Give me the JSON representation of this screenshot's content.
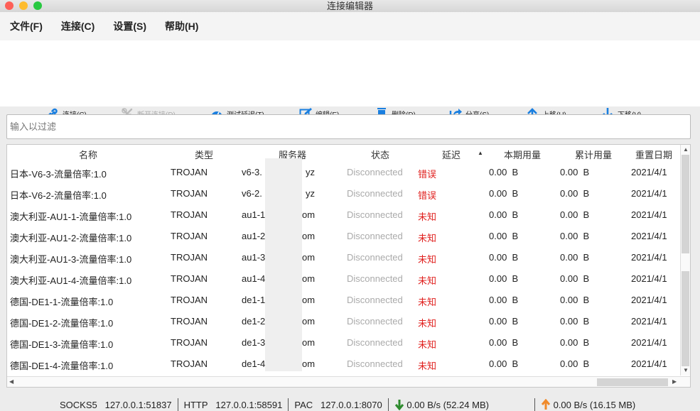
{
  "window": {
    "title": "连接编辑器"
  },
  "menu": [
    "文件(F)",
    "连接(C)",
    "设置(S)",
    "帮助(H)"
  ],
  "toolbar": [
    {
      "label": "连接(C)",
      "icon": "link-icon",
      "enabled": true
    },
    {
      "label": "断开连接(D)",
      "icon": "unlink-icon",
      "enabled": false
    },
    {
      "label": "测试延迟(T)",
      "icon": "speedometer-icon",
      "enabled": true
    },
    {
      "label": "编辑(E)",
      "icon": "edit-icon",
      "enabled": true
    },
    {
      "label": "删除(D)",
      "icon": "trash-icon",
      "enabled": true
    },
    {
      "label": "分享(S)",
      "icon": "share-icon",
      "enabled": true
    },
    {
      "label": "上移(U)",
      "icon": "arrow-up-icon",
      "enabled": true
    },
    {
      "label": "下移(V)",
      "icon": "arrow-down-icon",
      "enabled": true
    }
  ],
  "filter": {
    "placeholder": "输入以过滤",
    "value": ""
  },
  "table": {
    "columns": [
      "名称",
      "类型",
      "服务器",
      "状态",
      "延迟",
      "本期用量",
      "累计用量",
      "重置日期"
    ],
    "sort_indicator": "▲",
    "rows": [
      {
        "name": "日本-V6-3-流量倍率:1.0",
        "type": "TROJAN",
        "server_pre": "v6-3.",
        "server_post": "yz",
        "status": "Disconnected",
        "latency": "错误",
        "usage": "0.00  B",
        "total": "0.00  B",
        "reset": "2021/4/1"
      },
      {
        "name": "日本-V6-2-流量倍率:1.0",
        "type": "TROJAN",
        "server_pre": "v6-2.",
        "server_post": "yz",
        "status": "Disconnected",
        "latency": "错误",
        "usage": "0.00  B",
        "total": "0.00  B",
        "reset": "2021/4/1"
      },
      {
        "name": "澳大利亚-AU1-1-流量倍率:1.0",
        "type": "TROJAN",
        "server_pre": "au1-1.",
        "server_post": "om",
        "status": "Disconnected",
        "latency": "未知",
        "usage": "0.00  B",
        "total": "0.00  B",
        "reset": "2021/4/1"
      },
      {
        "name": "澳大利亚-AU1-2-流量倍率:1.0",
        "type": "TROJAN",
        "server_pre": "au1-2",
        "server_post": "om",
        "status": "Disconnected",
        "latency": "未知",
        "usage": "0.00  B",
        "total": "0.00  B",
        "reset": "2021/4/1"
      },
      {
        "name": "澳大利亚-AU1-3-流量倍率:1.0",
        "type": "TROJAN",
        "server_pre": "au1-3",
        "server_post": "om",
        "status": "Disconnected",
        "latency": "未知",
        "usage": "0.00  B",
        "total": "0.00  B",
        "reset": "2021/4/1"
      },
      {
        "name": "澳大利亚-AU1-4-流量倍率:1.0",
        "type": "TROJAN",
        "server_pre": "au1-4",
        "server_post": "om",
        "status": "Disconnected",
        "latency": "未知",
        "usage": "0.00  B",
        "total": "0.00  B",
        "reset": "2021/4/1"
      },
      {
        "name": "德国-DE1-1-流量倍率:1.0",
        "type": "TROJAN",
        "server_pre": "de1-1.",
        "server_post": "om",
        "status": "Disconnected",
        "latency": "未知",
        "usage": "0.00  B",
        "total": "0.00  B",
        "reset": "2021/4/1"
      },
      {
        "name": "德国-DE1-2-流量倍率:1.0",
        "type": "TROJAN",
        "server_pre": "de1-2",
        "server_post": "om",
        "status": "Disconnected",
        "latency": "未知",
        "usage": "0.00  B",
        "total": "0.00  B",
        "reset": "2021/4/1"
      },
      {
        "name": "德国-DE1-3-流量倍率:1.0",
        "type": "TROJAN",
        "server_pre": "de1-3",
        "server_post": "om",
        "status": "Disconnected",
        "latency": "未知",
        "usage": "0.00  B",
        "total": "0.00  B",
        "reset": "2021/4/1"
      },
      {
        "name": "德国-DE1-4-流量倍率:1.0",
        "type": "TROJAN",
        "server_pre": "de1-4",
        "server_post": "om",
        "status": "Disconnected",
        "latency": "未知",
        "usage": "0.00  B",
        "total": "0.00  B",
        "reset": "2021/4/1"
      }
    ]
  },
  "statusbar": {
    "socks_label": "SOCKS5",
    "socks": "127.0.0.1:51837",
    "http_label": "HTTP",
    "http": "127.0.0.1:58591",
    "pac_label": "PAC",
    "pac": "127.0.0.1:8070",
    "down": "0.00 B/s (52.24 MB)",
    "up": "0.00 B/s (16.15 MB)"
  },
  "colors": {
    "accent": "#1a7fe0",
    "error": "#e0201e",
    "down": "#2e8b2e",
    "up": "#f08a2a"
  }
}
